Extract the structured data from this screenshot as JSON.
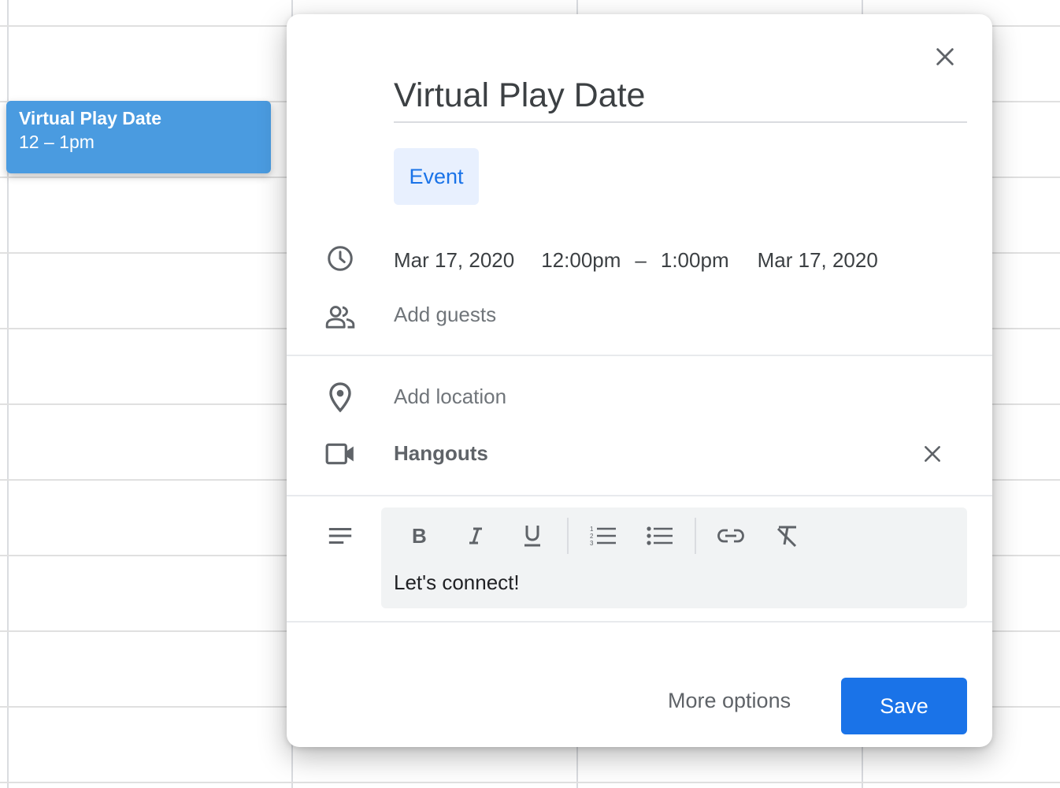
{
  "calendar_event": {
    "title": "Virtual Play Date",
    "time": "12 – 1pm",
    "color": "#4a9be0"
  },
  "dialog": {
    "title": "Virtual Play Date",
    "type_chip": "Event",
    "start_date": "Mar 17, 2020",
    "start_time": "12:00pm",
    "dash": "–",
    "end_time": "1:00pm",
    "end_date": "Mar 17, 2020",
    "guests_placeholder": "Add guests",
    "location_placeholder": "Add location",
    "conference": "Hangouts",
    "description": "Let's connect!",
    "toolbar": [
      "bold",
      "italic",
      "underline",
      "numbered-list",
      "bulleted-list",
      "link",
      "clear-formatting"
    ],
    "more_options": "More options",
    "save": "Save",
    "accent": "#1a73e8"
  },
  "icons": {
    "close": "close-icon",
    "time": "clock-icon",
    "guests": "people-icon",
    "location": "location-pin-icon",
    "video": "video-camera-icon",
    "description": "notes-icon"
  }
}
